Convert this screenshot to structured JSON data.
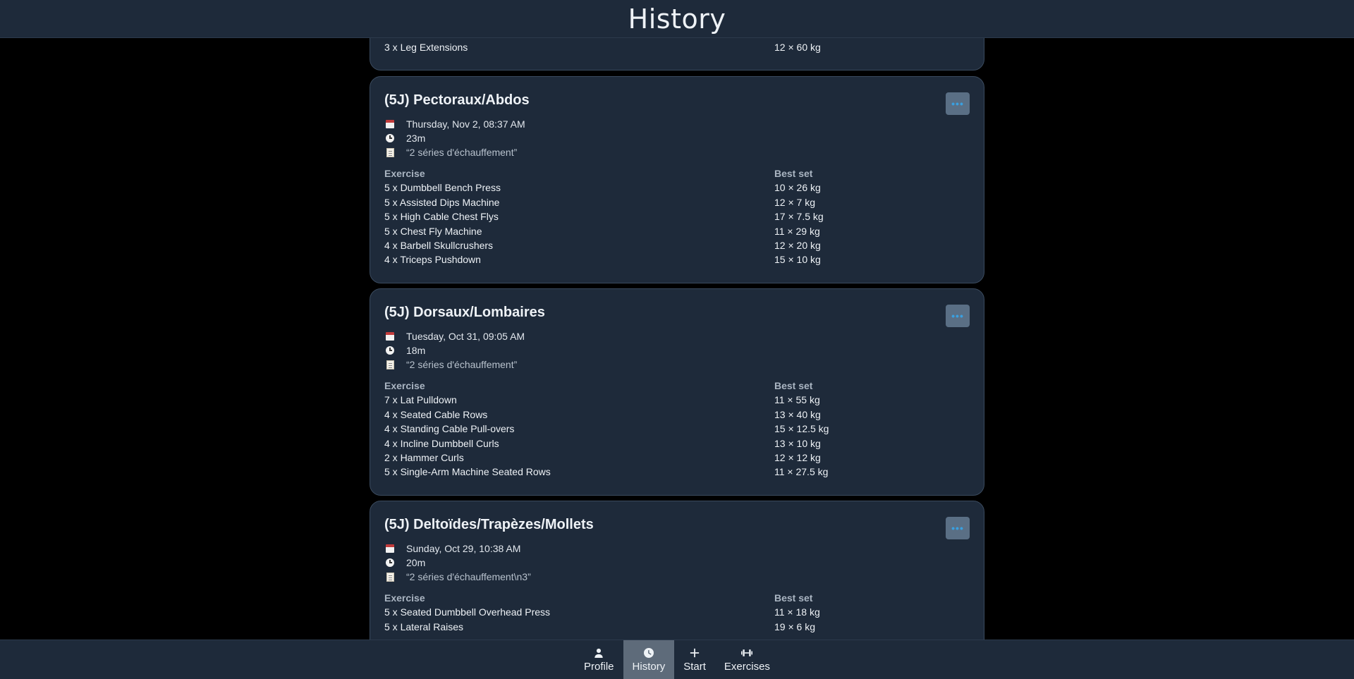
{
  "header": {
    "title": "History"
  },
  "labels": {
    "exercise": "Exercise",
    "best_set": "Best set",
    "menu": "•••"
  },
  "partial_card": {
    "rows": [
      {
        "name": "3 x Leg Extensions",
        "best": "12 × 60 kg"
      }
    ]
  },
  "workouts": [
    {
      "title": "(5J) Pectoraux/Abdos",
      "date": "Thursday, Nov 2, 08:37 AM",
      "duration": "23m",
      "note": "“2 séries d'échauffement”",
      "exercises": [
        {
          "name": "5 x Dumbbell Bench Press",
          "best": "10 × 26 kg"
        },
        {
          "name": "5 x Assisted Dips Machine",
          "best": "12 × 7 kg"
        },
        {
          "name": "5 x High Cable Chest Flys",
          "best": "17 × 7.5 kg"
        },
        {
          "name": "5 x Chest Fly Machine",
          "best": "11 × 29 kg"
        },
        {
          "name": "4 x Barbell Skullcrushers",
          "best": "12 × 20 kg"
        },
        {
          "name": "4 x Triceps Pushdown",
          "best": "15 × 10 kg"
        }
      ]
    },
    {
      "title": "(5J) Dorsaux/Lombaires",
      "date": "Tuesday, Oct 31, 09:05 AM",
      "duration": "18m",
      "note": "“2 séries d'échauffement”",
      "exercises": [
        {
          "name": "7 x Lat Pulldown",
          "best": "11 × 55 kg"
        },
        {
          "name": "4 x Seated Cable Rows",
          "best": "13 × 40 kg"
        },
        {
          "name": "4 x Standing Cable Pull-overs",
          "best": "15 × 12.5 kg"
        },
        {
          "name": "4 x Incline Dumbbell Curls",
          "best": "13 × 10 kg"
        },
        {
          "name": "2 x Hammer Curls",
          "best": "12 × 12 kg"
        },
        {
          "name": "5 x Single-Arm Machine Seated Rows",
          "best": "11 × 27.5 kg"
        }
      ]
    },
    {
      "title": "(5J) Deltoïdes/Trapèzes/Mollets",
      "date": "Sunday, Oct 29, 10:38 AM",
      "duration": "20m",
      "note": "“2 séries d'échauffement\\n3”",
      "exercises": [
        {
          "name": "5 x Seated Dumbbell Overhead Press",
          "best": "11 × 18 kg"
        },
        {
          "name": "5 x Lateral Raises",
          "best": "19 × 6 kg"
        }
      ]
    }
  ],
  "nav": {
    "items": [
      {
        "label": "Profile",
        "icon": "person-icon"
      },
      {
        "label": "History",
        "icon": "clock-icon"
      },
      {
        "label": "Start",
        "icon": "plus-icon"
      },
      {
        "label": "Exercises",
        "icon": "dumbbell-icon"
      }
    ],
    "active": "History"
  }
}
